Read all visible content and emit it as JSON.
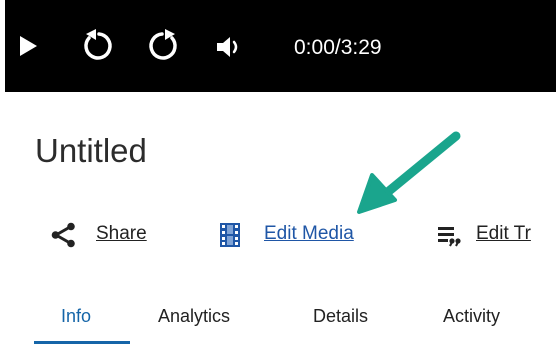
{
  "colors": {
    "player_bg": "#000000",
    "link": "#1f56a6",
    "share_link": "#222222",
    "tab_active": "#1565a8",
    "arrow": "#1aa58d",
    "edit_media_icon": "#1f56a6"
  },
  "player": {
    "play_icon": "play-icon",
    "rewind_icon": "rewind-icon",
    "forward_icon": "forward-icon",
    "volume_icon": "volume-icon",
    "time": "0:00/3:29"
  },
  "media": {
    "title": "Untitled"
  },
  "actions": [
    {
      "label": "Share",
      "icon": "share-icon"
    },
    {
      "label": "Edit Media",
      "icon": "film-icon"
    },
    {
      "label": "Edit Tr",
      "icon": "captions-icon"
    }
  ],
  "tabs": [
    {
      "label": "Info",
      "active": true
    },
    {
      "label": "Analytics",
      "active": false
    },
    {
      "label": "Details",
      "active": false
    },
    {
      "label": "Activity",
      "active": false
    }
  ],
  "annotation": {
    "arrow_icon": "pointer-arrow-icon"
  }
}
